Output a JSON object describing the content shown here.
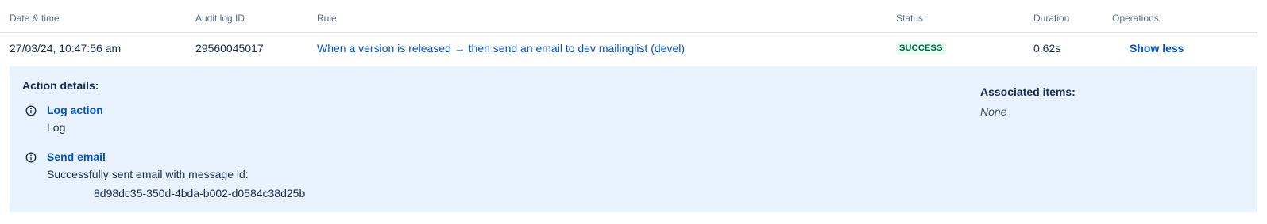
{
  "columns": {
    "date": "Date & time",
    "audit_id": "Audit log ID",
    "rule": "Rule",
    "status": "Status",
    "duration": "Duration",
    "operations": "Operations"
  },
  "row": {
    "date": "27/03/24, 10:47:56 am",
    "audit_id": "29560045017",
    "rule": "When a version is released → then send an email to dev mailinglist (devel)",
    "status": "SUCCESS",
    "duration": "0.62s",
    "operation": "Show less"
  },
  "details": {
    "title": "Action details:",
    "actions": [
      {
        "title": "Log action",
        "description": "Log",
        "icon": "info-icon"
      },
      {
        "title": "Send email",
        "description": "Successfully sent email with message id:",
        "message_id": "8d98dc35-350d-4bda-b002-d0584c38d25b",
        "icon": "info-icon"
      }
    ],
    "associated_title": "Associated items:",
    "associated_value": "None"
  },
  "colors": {
    "link": "#0052cc",
    "success_text": "#006644",
    "success_bg": "#e3fcef",
    "details_bg": "#e9f2ff"
  }
}
